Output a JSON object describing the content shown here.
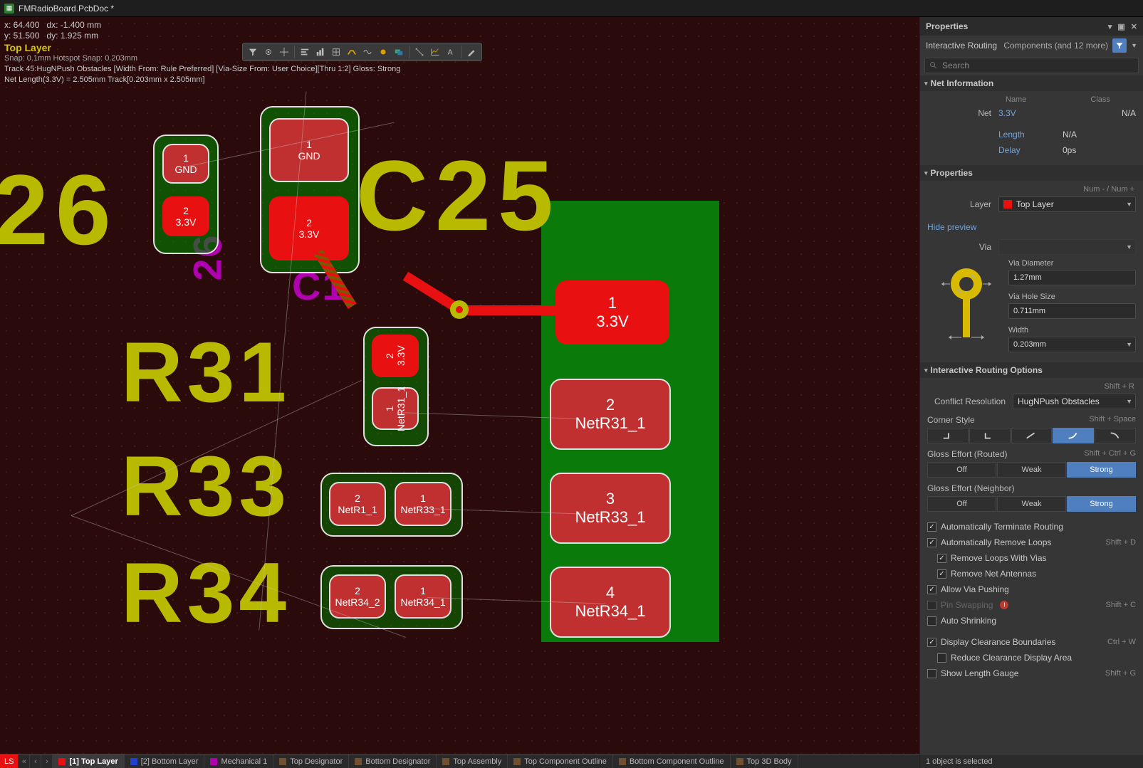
{
  "titlebar": {
    "filename": "FMRadioBoard.PcbDoc *"
  },
  "hud": {
    "x": "x: 64.400",
    "dx": "dx: -1.400  mm",
    "y": "y: 51.500",
    "dy": "dy:  1.925  mm",
    "layer": "Top Layer",
    "snap": "Snap: 0.1mm Hotspot Snap: 0.203mm",
    "track": "Track 45:HugNPush Obstacles [Width From: Rule Preferred]  [Via-Size From: User Choice][Thru 1:2] Gloss: Strong",
    "netlen": "Net Length(3.3V) = 2.505mm Track[0.203mm x 2.505mm]"
  },
  "pcb": {
    "silk": {
      "s26": "26",
      "c25": "C25",
      "r31": "R31",
      "r33": "R33",
      "r34": "R34",
      "v26": "26",
      "c1": "C1"
    },
    "pads": {
      "p26_1": {
        "n": "1",
        "net": "GND"
      },
      "p26_2": {
        "n": "2",
        "net": "3.3V"
      },
      "p25_1": {
        "n": "1",
        "net": "GND"
      },
      "p25_2": {
        "n": "2",
        "net": "3.3V"
      },
      "r31_2": {
        "n": "2",
        "net": "3.3V"
      },
      "r31_1": {
        "n": "1",
        "net": "NetR31_1"
      },
      "r33_2": {
        "n": "2",
        "net": "NetR1_1"
      },
      "r33_1": {
        "n": "1",
        "net": "NetR33_1"
      },
      "r34_2": {
        "n": "2",
        "net": "NetR34_2"
      },
      "r34_1": {
        "n": "1",
        "net": "NetR34_1"
      },
      "bp1": {
        "n": "1",
        "net": "3.3V"
      },
      "bp2": {
        "n": "2",
        "net": "NetR31_1"
      },
      "bp3": {
        "n": "3",
        "net": "NetR33_1"
      },
      "bp4": {
        "n": "4",
        "net": "NetR34_1"
      }
    }
  },
  "props": {
    "title": "Properties",
    "mode": "Interactive Routing",
    "scope": "Components (and 12 more)",
    "search_placeholder": "Search",
    "net_info": {
      "title": "Net Information",
      "name_hdr": "Name",
      "class_hdr": "Class",
      "net_lbl": "Net",
      "name": "3.3V",
      "class": "N/A",
      "length_lbl": "Length",
      "length": "N/A",
      "delay_lbl": "Delay",
      "delay": "0ps"
    },
    "properties": {
      "title": "Properties",
      "numnote": "Num - / Num +",
      "layer_lbl": "Layer",
      "layer": "Top Layer",
      "hide_preview": "Hide preview",
      "via_lbl": "Via",
      "via": "",
      "via_diam_lbl": "Via Diameter",
      "via_diam": "1.27mm",
      "via_hole_lbl": "Via Hole Size",
      "via_hole": "0.711mm",
      "width_lbl": "Width",
      "width": "0.203mm"
    },
    "iro": {
      "title": "Interactive Routing Options",
      "shift_r": "Shift + R",
      "conflict_lbl": "Conflict Resolution",
      "conflict": "HugNPush Obstacles",
      "corner_lbl": "Corner Style",
      "corner_hint": "Shift + Space",
      "gloss_routed_lbl": "Gloss Effort (Routed)",
      "gloss_routed_hint": "Shift + Ctrl + G",
      "gloss_neighbor_lbl": "Gloss Effort (Neighbor)",
      "opts3": {
        "off": "Off",
        "weak": "Weak",
        "strong": "Strong"
      },
      "chk_auto_term": "Automatically Terminate Routing",
      "chk_auto_loops": "Automatically Remove Loops",
      "hint_loops": "Shift + D",
      "chk_loops_vias": "Remove Loops With Vias",
      "chk_net_ant": "Remove Net Antennas",
      "chk_via_push": "Allow Via Pushing",
      "chk_pin_swap": "Pin Swapping",
      "hint_pin": "Shift + C",
      "chk_auto_shrink": "Auto Shrinking",
      "chk_clearance": "Display Clearance Boundaries",
      "hint_clear": "Ctrl + W",
      "chk_reduce": "Reduce Clearance Display Area",
      "chk_length": "Show Length Gauge",
      "hint_length": "Shift + G"
    }
  },
  "layertabs": {
    "ls": "LS",
    "top": "[1] Top Layer",
    "bottom": "[2] Bottom Layer",
    "mech": "Mechanical 1",
    "tdes": "Top Designator",
    "bdes": "Bottom Designator",
    "tasm": "Top Assembly",
    "tco": "Top Component Outline",
    "bco": "Bottom Component Outline",
    "t3d": "Top 3D Body"
  },
  "status": "1 object is selected"
}
